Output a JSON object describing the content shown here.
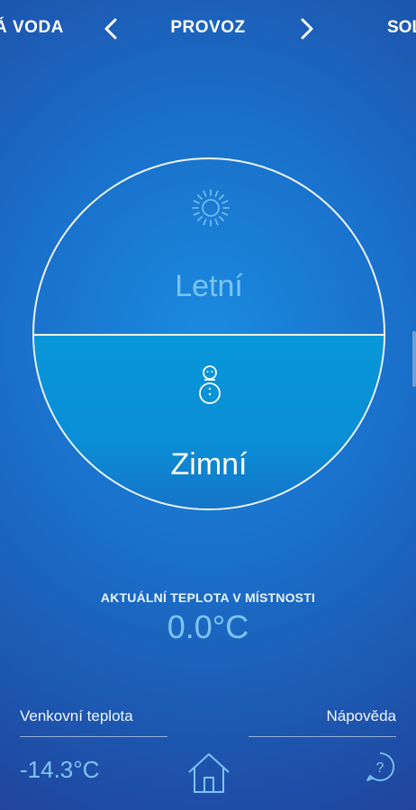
{
  "nav": {
    "prev_label": "Á VODA",
    "title": "PROVOZ",
    "next_label": "SOL"
  },
  "modes": {
    "summer": {
      "label": "Letní",
      "icon": "sun-icon"
    },
    "winter": {
      "label": "Zimní",
      "icon": "snowman-icon",
      "selected": true
    }
  },
  "room_temp": {
    "label": "AKTUÁLNÍ TEPLOTA V MÍSTNOSTI",
    "value": "0.0°C"
  },
  "outdoor": {
    "label": "Venkovní teplota",
    "value": "-14.3°C"
  },
  "help": {
    "label": "Nápověda",
    "icon": "help-bubble-icon"
  },
  "home": {
    "icon": "home-icon"
  },
  "colors": {
    "selected_mode": "#0a8ed6",
    "value_text": "#7fc4f4",
    "background_dark": "#233f95"
  }
}
